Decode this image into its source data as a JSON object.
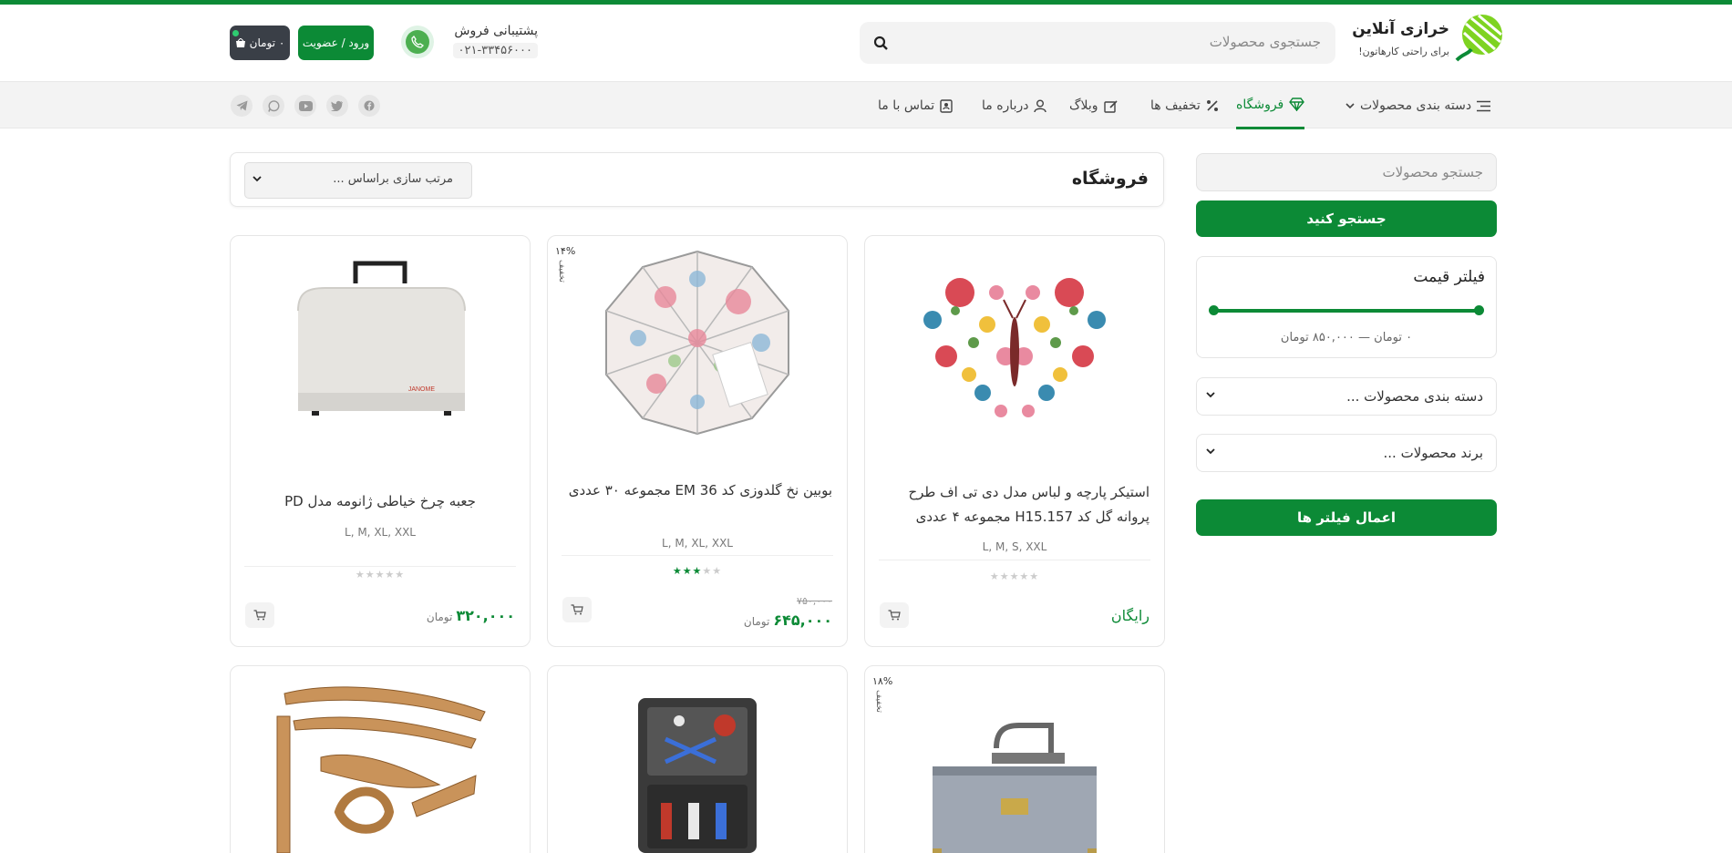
{
  "header": {
    "logo_name": "خرازی آنلاین",
    "logo_tagline": "برای راحتی کارهاتون!",
    "search_placeholder": "جستجوی محصولات",
    "support_title": "پشتیبانی فروش",
    "support_phone": "۰۲۱-۳۳۴۵۶۰۰۰",
    "login_label": "ورود / عضویت",
    "cart_label": "۰ تومان"
  },
  "nav": {
    "items": [
      {
        "label": "دسته بندی محصولات",
        "icon": "menu-icon"
      },
      {
        "label": "فروشگاه",
        "icon": "diamond-icon",
        "active": true
      },
      {
        "label": "تخفیف ها",
        "icon": "percent-icon"
      },
      {
        "label": "وبلاگ",
        "icon": "edit-icon"
      },
      {
        "label": "درباره ما",
        "icon": "user-icon"
      },
      {
        "label": "تماس با ما",
        "icon": "contact-icon"
      }
    ],
    "social": [
      "facebook-icon",
      "twitter-icon",
      "youtube-icon",
      "whatsapp-icon",
      "telegram-icon"
    ]
  },
  "sidebar": {
    "search_placeholder": "جستجو محصولات",
    "search_button": "جستجو کنید",
    "price_filter_title": "فیلتر قیمت",
    "price_range_text": "۰ تومان — ۸۵۰,۰۰۰ تومان",
    "price_range": {
      "min": 0,
      "max": 850000
    },
    "category_select": "دسته بندی محصولات ...",
    "brand_select": "برند محصولات ...",
    "apply_button": "اعمال فیلتر ها"
  },
  "main": {
    "title": "فروشگاه",
    "sort_label": "مرتب سازی براساس ..."
  },
  "products": [
    {
      "name": "استیکر پارچه و لباس مدل دی تی اف طرح پروانه گل کد H15.157 مجموعه ۴ عددی",
      "sizes": "L, M, S, XXL",
      "price_text": "رایگان",
      "rating": 0
    },
    {
      "name": "بوبین نخ گلدوزی کد EM 36 مجموعه ۳۰ عددی",
      "sizes": "L, M, XL, XXL",
      "old_price": "۷۵۰,۰۰۰",
      "price": "۶۴۵,۰۰۰",
      "currency": "تومان",
      "rating": 3,
      "discount": "۱۴%",
      "discount_tag": "تخفیف"
    },
    {
      "name": "جعبه چرخ خیاطی ژانومه مدل PD",
      "sizes": "L, M, XL, XXL",
      "price": "۳۲۰,۰۰۰",
      "currency": "تومان",
      "rating": 0
    },
    {
      "discount": "۱۸%",
      "discount_tag": "تخفیف"
    }
  ],
  "colors": {
    "brand": "#0c8a36",
    "dark": "#3a3f47"
  }
}
